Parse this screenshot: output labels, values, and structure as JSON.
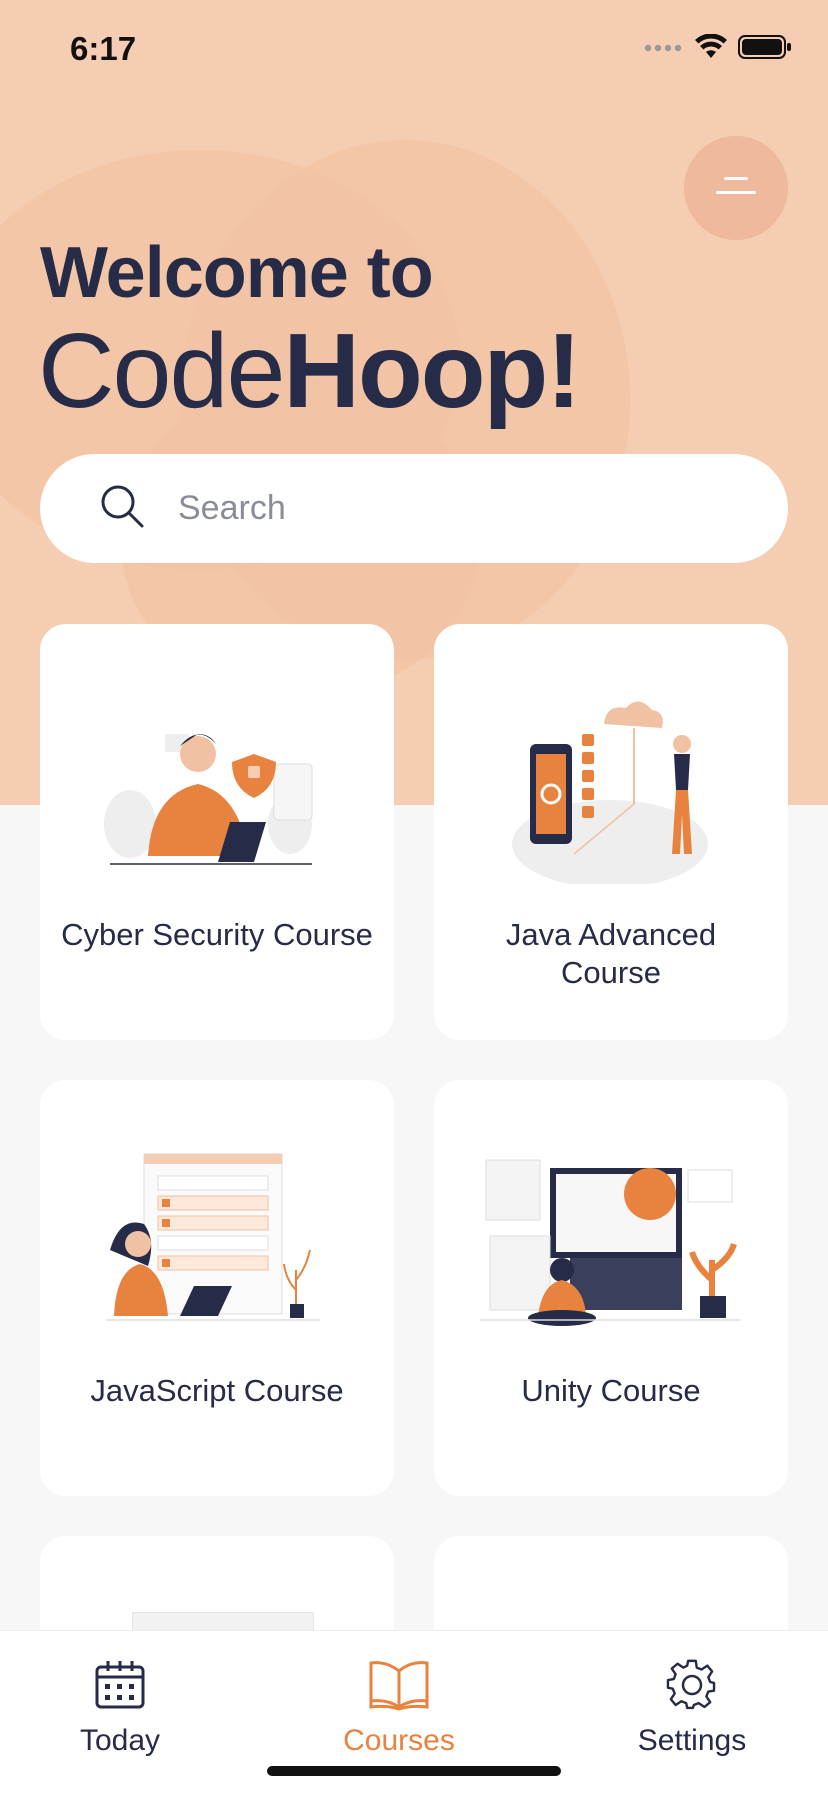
{
  "status_bar": {
    "time": "6:17"
  },
  "hero": {
    "welcome": "Welcome to",
    "brand_regular": "Code",
    "brand_bold": "Hoop!"
  },
  "search": {
    "placeholder": "Search"
  },
  "courses": [
    {
      "title": "Cyber Security Course"
    },
    {
      "title": "Java Advanced Course"
    },
    {
      "title": "JavaScript Course"
    },
    {
      "title": "Unity Course"
    }
  ],
  "tabbar": {
    "items": [
      {
        "label": "Today",
        "icon": "calendar-icon"
      },
      {
        "label": "Courses",
        "icon": "book-icon"
      },
      {
        "label": "Settings",
        "icon": "gear-icon"
      }
    ],
    "active": "Courses"
  },
  "colors": {
    "accent": "#e8823f",
    "hero_bg": "#f5cdb3",
    "text": "#262b47"
  }
}
